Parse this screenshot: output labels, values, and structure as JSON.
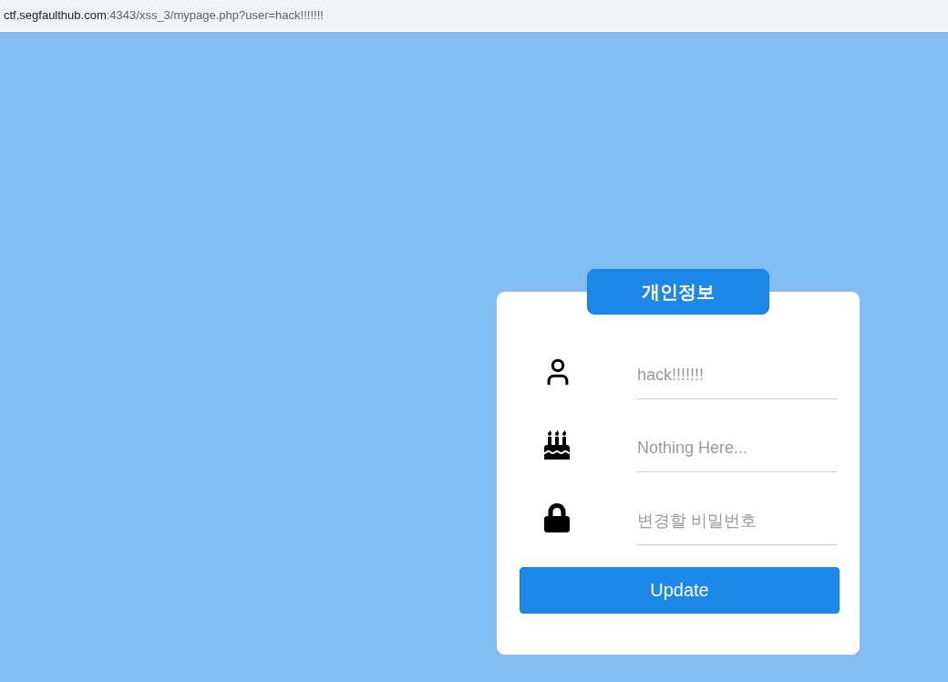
{
  "address_bar": {
    "host": "ctf.segfaulthub.com",
    "path": ":4343/xss_3/mypage.php?user=hack!!!!!!!"
  },
  "card": {
    "title": "개인정보",
    "fields": [
      {
        "kind": "user",
        "placeholder": "hack!!!!!!!"
      },
      {
        "kind": "cake",
        "placeholder": "Nothing Here..."
      },
      {
        "kind": "lock",
        "placeholder": "변경할 비밀번호"
      }
    ],
    "button": "Update"
  }
}
